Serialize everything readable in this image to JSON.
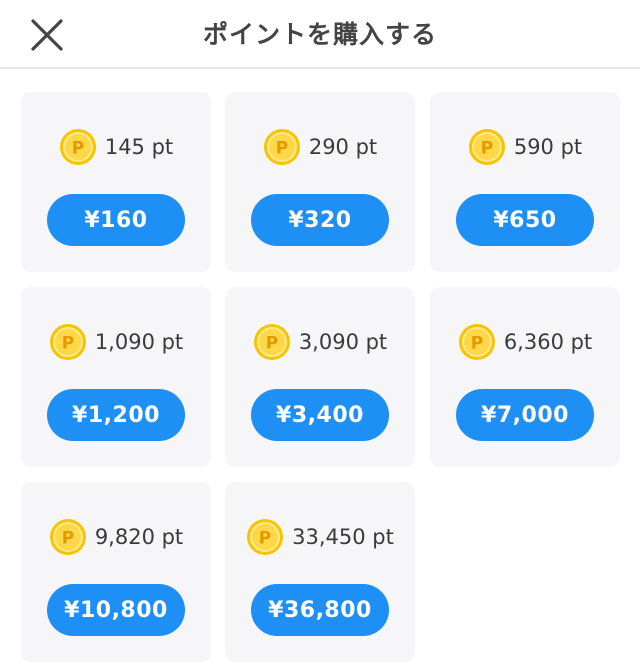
{
  "header": {
    "title": "ポイントを購入する",
    "close_icon": "close-icon"
  },
  "colors": {
    "accent": "#1e8ff5",
    "card_bg": "#f6f6f8",
    "coin_gold": "#f5b800"
  },
  "point_unit_icon": "coin-p-icon",
  "packages": [
    {
      "points": "145 pt",
      "price": "¥160"
    },
    {
      "points": "290 pt",
      "price": "¥320"
    },
    {
      "points": "590 pt",
      "price": "¥650"
    },
    {
      "points": "1,090 pt",
      "price": "¥1,200"
    },
    {
      "points": "3,090 pt",
      "price": "¥3,400"
    },
    {
      "points": "6,360 pt",
      "price": "¥7,000"
    },
    {
      "points": "9,820 pt",
      "price": "¥10,800"
    },
    {
      "points": "33,450 pt",
      "price": "¥36,800"
    }
  ]
}
